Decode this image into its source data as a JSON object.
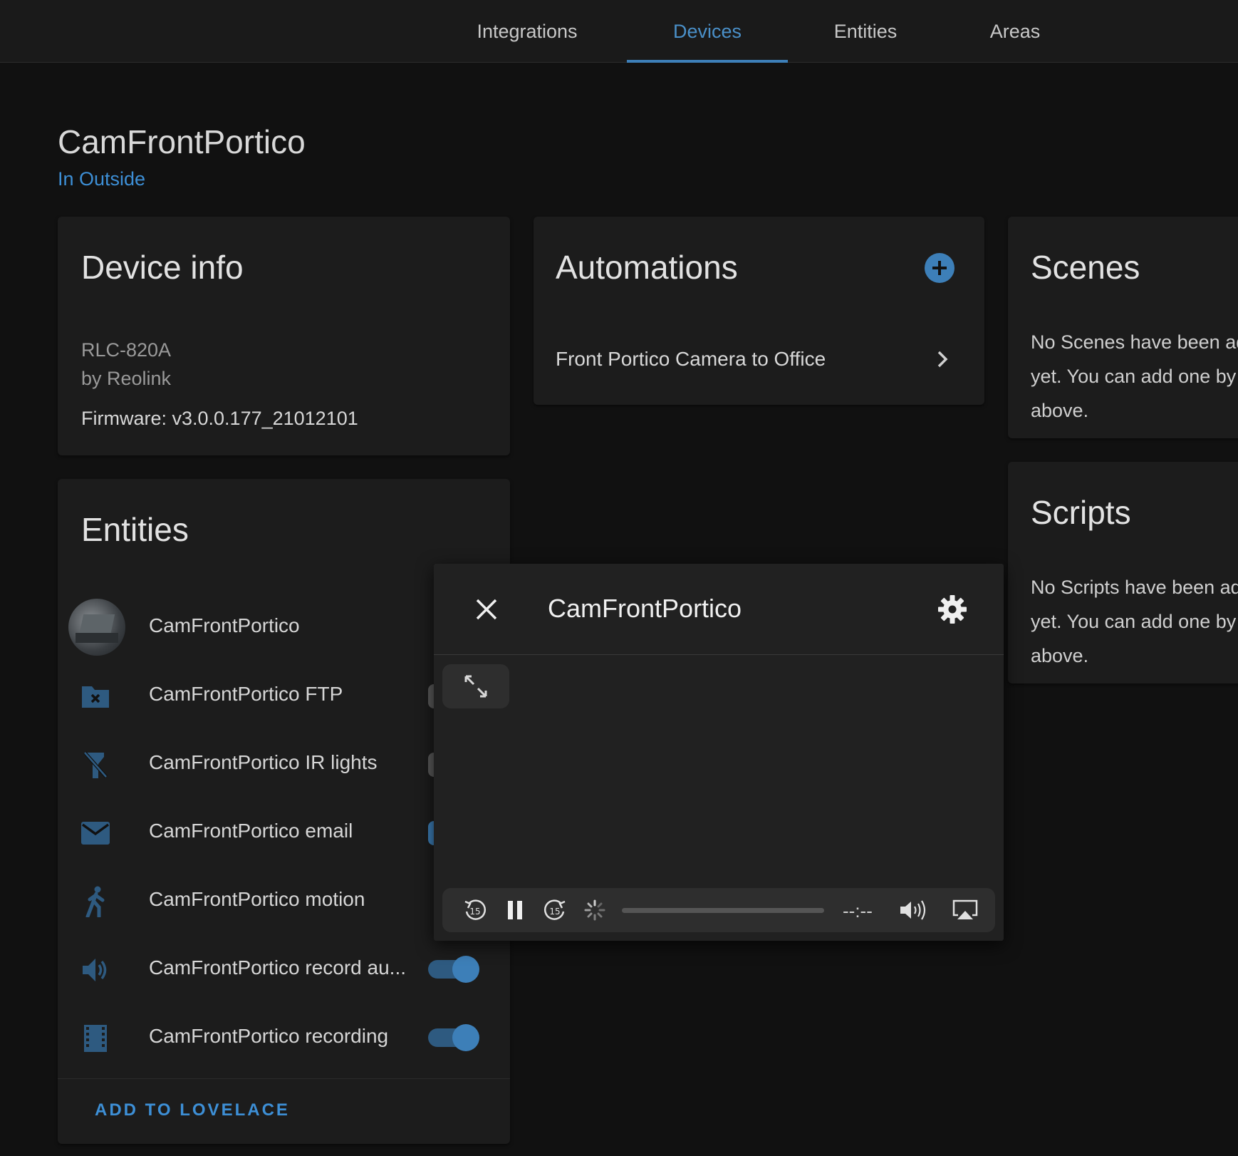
{
  "tabs": [
    {
      "label": "Integrations",
      "active": false
    },
    {
      "label": "Devices",
      "active": true
    },
    {
      "label": "Entities",
      "active": false
    },
    {
      "label": "Areas",
      "active": false
    }
  ],
  "device": {
    "name": "CamFrontPortico",
    "area": "In Outside"
  },
  "device_info": {
    "title": "Device info",
    "model": "RLC-820A",
    "manufacturer": "by Reolink",
    "firmware": "Firmware: v3.0.0.177_21012101"
  },
  "automations": {
    "title": "Automations",
    "items": [
      "Front Portico Camera to Office"
    ]
  },
  "scenes": {
    "title": "Scenes",
    "lines": [
      "No Scenes have been ad",
      "yet. You can add one by",
      "above."
    ]
  },
  "scripts": {
    "title": "Scripts",
    "lines": [
      "No Scripts have been ad",
      "yet. You can add one by",
      "above."
    ]
  },
  "entities": {
    "title": "Entities",
    "items": [
      {
        "label": "CamFrontPortico",
        "icon": "camera-thumbnail"
      },
      {
        "label": "CamFrontPortico FTP",
        "icon": "folder-remove-icon"
      },
      {
        "label": "CamFrontPortico IR lights",
        "icon": "flashlight-off-icon"
      },
      {
        "label": "CamFrontPortico email",
        "icon": "email-icon"
      },
      {
        "label": "CamFrontPortico motion",
        "icon": "walk-icon"
      },
      {
        "label": "CamFrontPortico record au...",
        "icon": "volume-icon",
        "toggle_on": true
      },
      {
        "label": "CamFrontPortico recording",
        "icon": "film-icon",
        "toggle_on": true
      }
    ],
    "add_button": "ADD TO LOVELACE"
  },
  "dialog": {
    "title": "CamFrontPortico",
    "time": "--:--",
    "skip_seconds": "15"
  },
  "colors": {
    "accent": "#3d7fb8",
    "background": "#111111",
    "card": "#1c1c1c"
  }
}
